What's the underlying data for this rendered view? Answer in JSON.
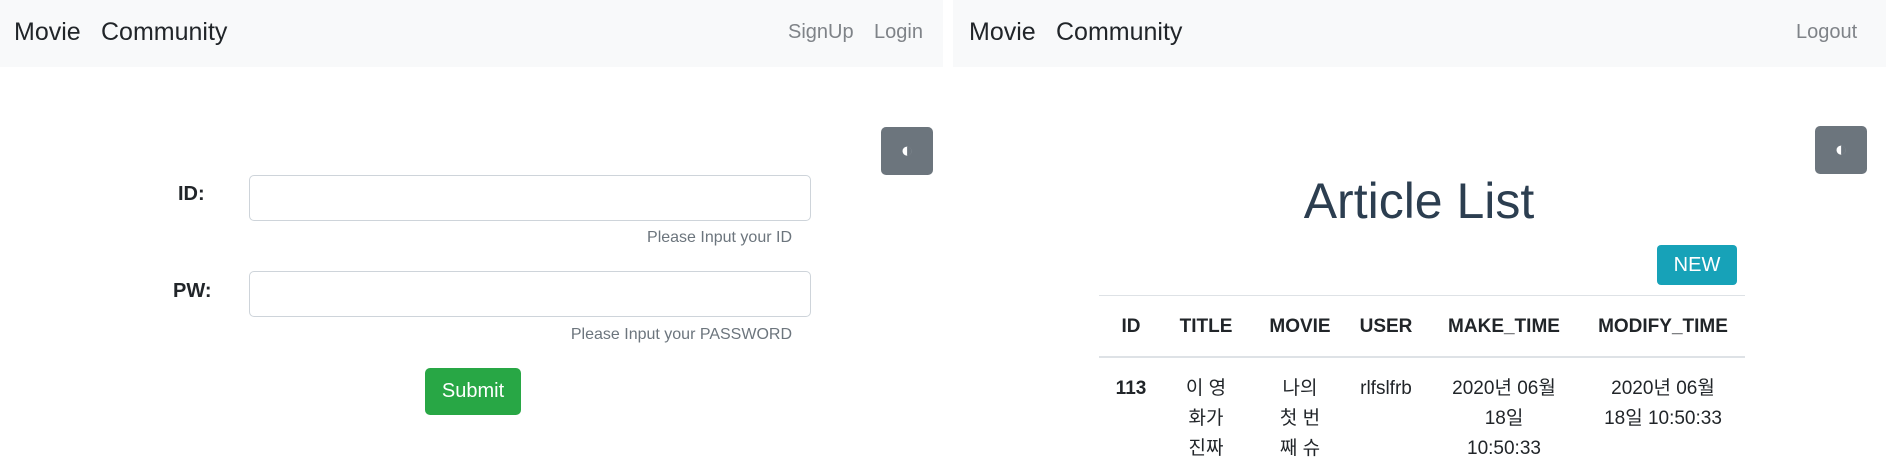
{
  "left": {
    "nav": {
      "brand": "Movie",
      "community": "Community",
      "signup": "SignUp",
      "login": "Login"
    },
    "theme_toggle": "◐",
    "form": {
      "id_label": "ID:",
      "id_help": "Please Input your ID",
      "pw_label": "PW:",
      "pw_help": "Please Input your PASSWORD",
      "submit": "Submit"
    }
  },
  "right": {
    "nav": {
      "brand": "Movie",
      "community": "Community",
      "logout": "Logout"
    },
    "theme_toggle": "◐",
    "title": "Article List",
    "new_button": "NEW",
    "table": {
      "headers": [
        "ID",
        "TITLE",
        "MOVIE",
        "USER",
        "MAKE_TIME",
        "MODIFY_TIME"
      ],
      "rows": [
        {
          "id": "113",
          "title": "이 영\n화가\n진짜",
          "movie": "나의\n첫 번\n째 슈",
          "user": "rlfslfrb",
          "make_time": "2020년 06월\n18일\n10:50:33",
          "modify_time": "2020년 06월\n18일 10:50:33"
        }
      ]
    }
  }
}
